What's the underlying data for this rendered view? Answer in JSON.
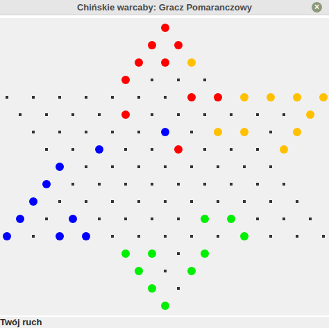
{
  "window": {
    "title": "Chińskie warcaby: Gracz Pomaranczowy",
    "close": "×"
  },
  "status_bar": "Twój ruch",
  "pieces": [
    {
      "row": 0,
      "index": 0,
      "color": "#ff0000"
    },
    {
      "row": 1,
      "index": 0,
      "color": "#ff0000"
    },
    {
      "row": 1,
      "index": 1,
      "color": "#ff0000"
    },
    {
      "row": 2,
      "index": 0,
      "color": "#ff0000"
    },
    {
      "row": 2,
      "index": 1,
      "color": "#ff0000"
    },
    {
      "row": 2,
      "index": 2,
      "color": "#ffc000"
    },
    {
      "row": 3,
      "index": 0,
      "color": "#ff0000"
    },
    {
      "row": 4,
      "index": 7,
      "color": "#ff0000"
    },
    {
      "row": 4,
      "index": 8,
      "color": "#ff0000"
    },
    {
      "row": 4,
      "index": 9,
      "color": "#ffc000"
    },
    {
      "row": 4,
      "index": 10,
      "color": "#ffc000"
    },
    {
      "row": 4,
      "index": 11,
      "color": "#ffc000"
    },
    {
      "row": 4,
      "index": 12,
      "color": "#ffc000"
    },
    {
      "row": 5,
      "index": 4,
      "color": "#ff0000"
    },
    {
      "row": 5,
      "index": 11,
      "color": "#ffc000"
    },
    {
      "row": 6,
      "index": 5,
      "color": "#0000ff"
    },
    {
      "row": 6,
      "index": 7,
      "color": "#ffc000"
    },
    {
      "row": 6,
      "index": 8,
      "color": "#ffc000"
    },
    {
      "row": 6,
      "index": 10,
      "color": "#ffc000"
    },
    {
      "row": 7,
      "index": 2,
      "color": "#0000ff"
    },
    {
      "row": 7,
      "index": 5,
      "color": "#ff0000"
    },
    {
      "row": 7,
      "index": 9,
      "color": "#ffc000"
    },
    {
      "row": 8,
      "index": 0,
      "color": "#0000ff"
    },
    {
      "row": 9,
      "index": 0,
      "color": "#0000ff"
    },
    {
      "row": 10,
      "index": 0,
      "color": "#0000ff"
    },
    {
      "row": 11,
      "index": 0,
      "color": "#0000ff"
    },
    {
      "row": 11,
      "index": 2,
      "color": "#0000ff"
    },
    {
      "row": 11,
      "index": 7,
      "color": "#00ee00"
    },
    {
      "row": 11,
      "index": 8,
      "color": "#00ee00"
    },
    {
      "row": 12,
      "index": 0,
      "color": "#0000ff"
    },
    {
      "row": 12,
      "index": 2,
      "color": "#0000ff"
    },
    {
      "row": 12,
      "index": 3,
      "color": "#0000ff"
    },
    {
      "row": 12,
      "index": 9,
      "color": "#00ee00"
    },
    {
      "row": 13,
      "index": 0,
      "color": "#00ee00"
    },
    {
      "row": 13,
      "index": 1,
      "color": "#00ee00"
    },
    {
      "row": 13,
      "index": 3,
      "color": "#00ee00"
    },
    {
      "row": 14,
      "index": 0,
      "color": "#00ee00"
    },
    {
      "row": 14,
      "index": 2,
      "color": "#00ee00"
    },
    {
      "row": 15,
      "index": 0,
      "color": "#00ee00"
    },
    {
      "row": 16,
      "index": 0,
      "color": "#00ee00"
    }
  ]
}
